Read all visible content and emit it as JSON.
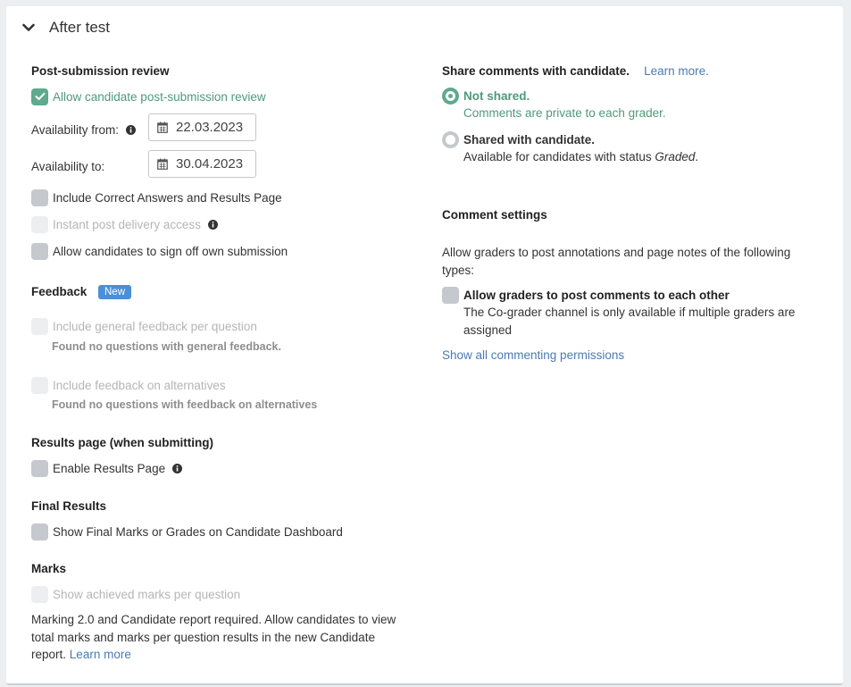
{
  "section": {
    "title": "After test",
    "icon": "chevron-down-icon"
  },
  "post_submission": {
    "heading": "Post-submission review",
    "allow_review_label": "Allow candidate post-submission review",
    "availability_from_label": "Availability from:",
    "availability_from_value": "22.03.2023",
    "availability_to_label": "Availability to:",
    "availability_to_value": "30.04.2023",
    "include_correct_label": "Include Correct Answers and Results Page",
    "instant_access_label": "Instant post delivery access",
    "sign_off_label": "Allow candidates to sign off own submission"
  },
  "feedback": {
    "heading": "Feedback",
    "badge": "New",
    "general_label": "Include general feedback per question",
    "general_note": "Found no questions with general feedback.",
    "alternatives_label": "Include feedback on alternatives",
    "alternatives_note": "Found no questions with feedback on alternatives"
  },
  "results_page": {
    "heading": "Results page (when submitting)",
    "enable_label": "Enable Results Page"
  },
  "final_results": {
    "heading": "Final Results",
    "show_label": "Show Final Marks or Grades on Candidate Dashboard"
  },
  "marks": {
    "heading": "Marks",
    "show_label": "Show achieved marks per question",
    "note_line1": "Marking 2.0 and Candidate report required. Allow candidates to view",
    "note_line2": "total marks and marks per question results in the new Candidate",
    "note_line3_prefix": "report.",
    "learn_more": "Learn more"
  },
  "share_comments": {
    "heading": "Share comments with candidate.",
    "learn_more": "Learn more.",
    "not_shared_label": "Not shared.",
    "not_shared_desc": "Comments are private to each grader.",
    "shared_label": "Shared with candidate.",
    "shared_desc_prefix": "Available for candidates with status",
    "shared_desc_status": "Graded",
    "shared_desc_suffix": "."
  },
  "comment_settings": {
    "heading": "Comment settings",
    "desc_line1": "Allow graders to post annotations and page notes of the following",
    "desc_line2": "types:",
    "allow_each_other_label": "Allow graders to post comments to each other",
    "co_grader_line1": "The Co-grader channel is only available if multiple graders are",
    "co_grader_line2": "assigned",
    "show_all_link": "Show all commenting permissions"
  },
  "colors": {
    "accent_green": "#5fa98c",
    "link_blue": "#4a7ab5",
    "badge_blue": "#4a90d9"
  }
}
